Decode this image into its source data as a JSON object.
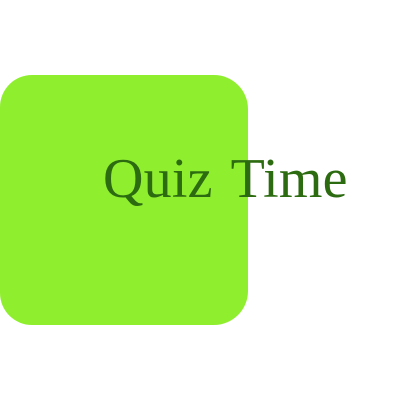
{
  "logo": {
    "word1": "Quiz",
    "word2": "Time"
  },
  "colors": {
    "block": "#8fef2f",
    "text": "#2c6b10",
    "background": "#ffffff"
  }
}
